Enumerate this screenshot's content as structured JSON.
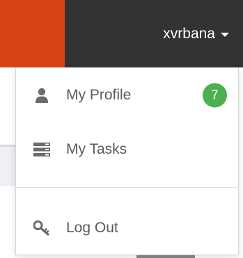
{
  "navbar": {
    "brand_color": "#d84315",
    "background_color": "#333333",
    "username": "xvrbana",
    "caret_icon": "caret-down-icon"
  },
  "dropdown": {
    "items": [
      {
        "label": "My Profile",
        "icon": "user-icon",
        "badge": "7"
      },
      {
        "label": "My Tasks",
        "icon": "tasks-icon"
      },
      {
        "label": "Log Out",
        "icon": "key-icon"
      }
    ],
    "badge_color": "#4caf50"
  }
}
